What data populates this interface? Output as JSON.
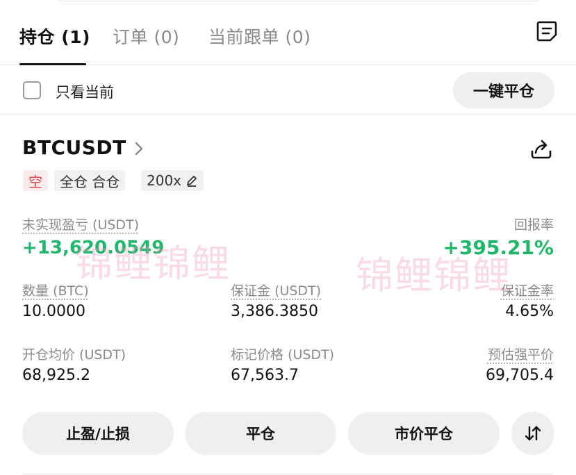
{
  "tabs": [
    {
      "label": "持仓 (1)",
      "active": true
    },
    {
      "label": "订单 (0)",
      "active": false
    },
    {
      "label": "当前跟单 (0)",
      "active": false
    }
  ],
  "filter": {
    "only_current_label": "只看当前",
    "only_current_checked": false,
    "close_all_label": "一键平仓"
  },
  "position": {
    "symbol": "BTCUSDT",
    "side": "空",
    "margin_mode": "全仓 合仓",
    "leverage": "200x",
    "pnl_label": "未实现盈亏 (USDT)",
    "pnl_value": "+13,620.0549",
    "roe_label": "回报率",
    "roe_value": "+395.21%",
    "size_label": "数量 (BTC)",
    "size_value": "10.0000",
    "margin_label": "保证金 (USDT)",
    "margin_value": "3,386.3850",
    "margin_ratio_label": "保证金率",
    "margin_ratio_value": "4.65%",
    "entry_label": "开仓均价 (USDT)",
    "entry_value": "68,925.2",
    "mark_label": "标记价格 (USDT)",
    "mark_value": "67,563.7",
    "liq_label": "预估强平价",
    "liq_value": "69,705.4"
  },
  "actions": {
    "tpsl_label": "止盈/止损",
    "close_label": "平仓",
    "market_close_label": "市价平仓"
  },
  "watermark": "锦鲤锦鲤",
  "colors": {
    "profit": "#1fb86a",
    "short": "#e0424a"
  },
  "icons": [
    "order-list-icon",
    "chevron-right-icon",
    "share-icon",
    "edit-icon",
    "swap-arrows-icon"
  ]
}
